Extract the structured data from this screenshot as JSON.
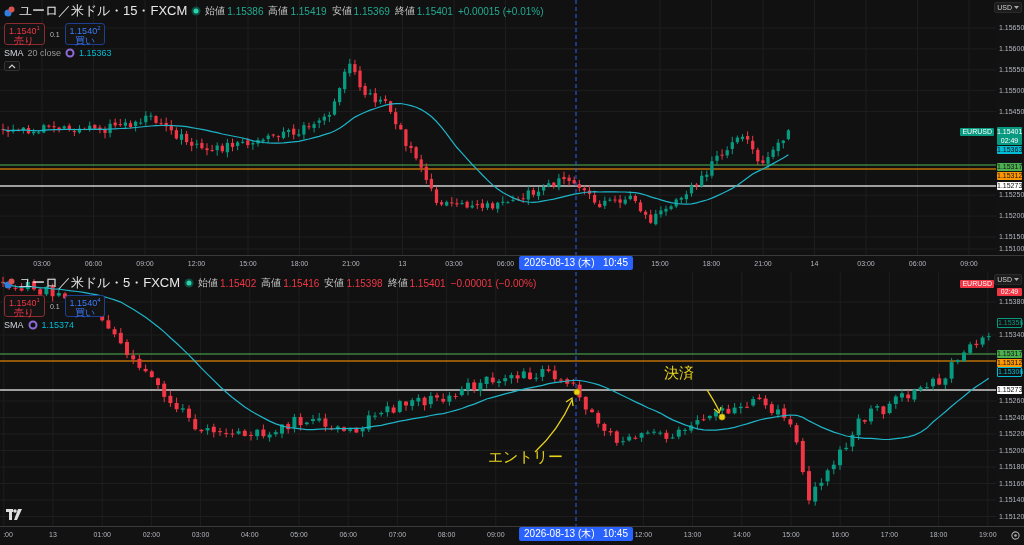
{
  "panes": [
    {
      "symbol": "ユーロ／米ドル・15・FXCM",
      "rising": true,
      "ohlc": [
        {
          "label": "始値",
          "value": "1.15386"
        },
        {
          "label": "高値",
          "value": "1.15419"
        },
        {
          "label": "安値",
          "value": "1.15369"
        },
        {
          "label": "終値",
          "value": "1.15401"
        }
      ],
      "change": "+0.00015 (+0.01%)",
      "sell": {
        "price": "1.1540$^{1}$",
        "label": "売り"
      },
      "spread": "0.1",
      "buy": {
        "price": "1.1540$^{2}$",
        "label": "買い"
      },
      "indicator": {
        "name": "SMA",
        "params": "20 close",
        "value": "1.15363"
      },
      "toggle_button": true,
      "currency": "USD",
      "symbol_tag": "EURUSD",
      "price_ticks": [
        "1.15650",
        "1.15600",
        "1.15550",
        "1.15500",
        "1.15450",
        "1.15250",
        "1.15200",
        "1.15150",
        "1.15100"
      ],
      "badges": [
        {
          "kind": "last",
          "text": "1.15401",
          "sub": "02:49",
          "color": "#089981"
        },
        {
          "kind": "filled",
          "text": "1.15363",
          "color": "#00bcd4"
        },
        {
          "kind": "filled",
          "text": "1.15317",
          "color": "#4caf50",
          "line": true
        },
        {
          "kind": "filled",
          "text": "1.15312",
          "color": "#ff9800",
          "line": true
        },
        {
          "kind": "filled",
          "text": "1.15273",
          "color": "#ffffff",
          "line": true
        }
      ],
      "time_ticks": [
        "03:00",
        "06:00",
        "09:00",
        "12:00",
        "15:00",
        "18:00",
        "21:00",
        "13",
        "03:00",
        "06:00",
        "15:00",
        "18:00",
        "21:00",
        "14",
        "03:00",
        "06:00",
        "09:00"
      ],
      "cursor_time": "2026-08-13 (木)   10:45"
    },
    {
      "symbol": "ユーロ／米ドル・5・FXCM",
      "rising": false,
      "ohlc": [
        {
          "label": "始値",
          "value": "1.15402"
        },
        {
          "label": "高値",
          "value": "1.15416"
        },
        {
          "label": "安値",
          "value": "1.15398"
        },
        {
          "label": "終値",
          "value": "1.15401"
        }
      ],
      "change": "−0.00001 (−0.00%)",
      "sell": {
        "price": "1.1540$^{1}$",
        "label": "売り"
      },
      "spread": "0.1",
      "buy": {
        "price": "1.1540$^{4}$",
        "label": "買い"
      },
      "indicator": {
        "name": "SMA",
        "value": "1.15374"
      },
      "currency": "USD",
      "symbol_tag": "EURUSD",
      "price_ticks": [
        "1.15380",
        "1.15340",
        "1.15260",
        "1.15240",
        "1.15220",
        "1.15200",
        "1.15180",
        "1.15160",
        "1.15140",
        "1.15120"
      ],
      "badges": [
        {
          "kind": "countdown",
          "text": "02:49",
          "color": "#f23645"
        },
        {
          "kind": "outline",
          "text": "1.15356",
          "color": "#089981"
        },
        {
          "kind": "filled",
          "text": "1.15317",
          "color": "#4caf50",
          "line": true
        },
        {
          "kind": "filled",
          "text": "1.15312",
          "color": "#ff9800",
          "line": true
        },
        {
          "kind": "outline",
          "text": "1.15306",
          "color": "#00bcd4"
        },
        {
          "kind": "filled",
          "text": "1.15273",
          "color": "#ffffff",
          "line": true
        }
      ],
      "time_ticks": [
        ":00",
        "13",
        "01:00",
        "02:00",
        "03:00",
        "04:00",
        "05:00",
        "06:00",
        "07:00",
        "08:00",
        "09:00",
        "12:00",
        "13:00",
        "14:00",
        "15:00",
        "16:00",
        "17:00",
        "18:00",
        "19:00"
      ],
      "cursor_time": "2026-08-13 (木)   10:45",
      "annotations": [
        {
          "kind": "entry",
          "text": "エントリー"
        },
        {
          "kind": "exit",
          "text": "決済"
        }
      ]
    }
  ]
}
